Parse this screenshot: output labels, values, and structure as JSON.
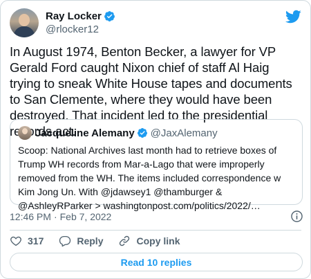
{
  "author": {
    "display_name": "Ray Locker",
    "handle": "@rlocker12"
  },
  "tweet": {
    "text": "In August 1974, Benton Becker, a lawyer for VP Gerald Ford caught Nixon chief of staff Al Haig trying to sneak White House tapes and documents to San Clemente, where they would have been destroyed. That incident led to the presidential records act."
  },
  "quote": {
    "display_name": "Jacqueline Alemany",
    "handle": "@JaxAlemany",
    "text": "Scoop: National Archives last month had to retrieve boxes of Trump WH records from Mar-a-Lago that were improperly removed from the WH. The items included correspondence w Kim Jong Un. With @jdawsey1 @thamburger & @AshleyRParker > washingtonpost.com/politics/2022/…"
  },
  "meta": {
    "time": "12:46 PM",
    "separator": "·",
    "date": "Feb 7, 2022"
  },
  "actions": {
    "like_count": "317",
    "reply_label": "Reply",
    "copy_link_label": "Copy link"
  },
  "read_replies_label": "Read 10 replies",
  "colors": {
    "accent": "#1d9bf0",
    "like": "#f91880",
    "text_secondary": "#536471",
    "border": "#cfd9de"
  },
  "icons": [
    "verified-badge-icon",
    "twitter-bird-icon",
    "info-icon",
    "heart-icon",
    "reply-icon",
    "link-icon"
  ]
}
